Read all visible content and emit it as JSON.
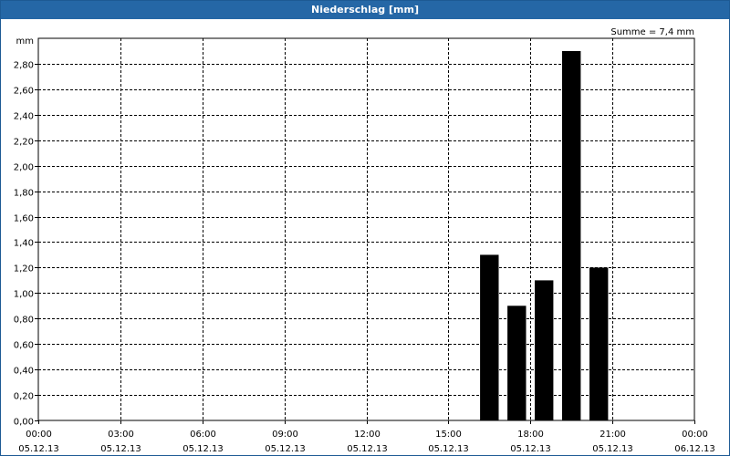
{
  "window": {
    "title": "Niederschlag [mm]"
  },
  "chart_data": {
    "type": "bar",
    "title": "Niederschlag [mm]",
    "ylabel": "mm",
    "annotation": "Summe = 7,4 mm",
    "ylim": [
      0,
      3.0
    ],
    "yticks": [
      "0,00",
      "0,20",
      "0,40",
      "0,60",
      "0,80",
      "1,00",
      "1,20",
      "1,40",
      "1,60",
      "1,80",
      "2,00",
      "2,20",
      "2,40",
      "2,60",
      "2,80"
    ],
    "xticks": [
      {
        "time": "00:00",
        "date": "05.12.13"
      },
      {
        "time": "03:00",
        "date": "05.12.13"
      },
      {
        "time": "06:00",
        "date": "05.12.13"
      },
      {
        "time": "09:00",
        "date": "05.12.13"
      },
      {
        "time": "12:00",
        "date": "05.12.13"
      },
      {
        "time": "15:00",
        "date": "05.12.13"
      },
      {
        "time": "18:00",
        "date": "05.12.13"
      },
      {
        "time": "21:00",
        "date": "05.12.13"
      },
      {
        "time": "00:00",
        "date": "06.12.13"
      }
    ],
    "x_range_hours": [
      0,
      24
    ],
    "bars": [
      {
        "start": "16:00",
        "end": "17:00",
        "value": 1.3
      },
      {
        "start": "17:00",
        "end": "18:00",
        "value": 0.9
      },
      {
        "start": "18:00",
        "end": "19:00",
        "value": 1.1
      },
      {
        "start": "19:00",
        "end": "20:00",
        "value": 2.9
      },
      {
        "start": "20:00",
        "end": "21:00",
        "value": 1.2
      }
    ],
    "grid": true,
    "bar_color": "#000000"
  }
}
